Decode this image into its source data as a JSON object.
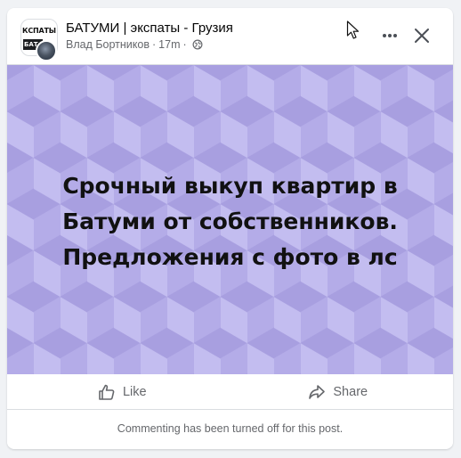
{
  "post": {
    "group_name": "БАТУМИ | экспаты - Грузия",
    "author": "Влад Бортников",
    "separator": "·",
    "time": "17m",
    "avatar_logo_top": "КСПАТЫ",
    "avatar_logo_bottom": "БАТ",
    "image_text_lines": [
      "Срочный выкуп квартир в",
      "Батуми от собственников.",
      "Предложения с фото в лс"
    ],
    "image_background_color": "#b4ace8"
  },
  "actions": {
    "like_label": "Like",
    "share_label": "Share"
  },
  "footer": {
    "comment_notice": "Commenting has been turned off for this post."
  },
  "icons": {
    "globe": "globe-icon",
    "more": "more-icon",
    "close": "close-icon",
    "like": "thumbs-up-icon",
    "share": "share-arrow-icon",
    "cursor": "mouse-cursor-icon"
  },
  "colors": {
    "secondary_text": "#65676b",
    "primary_text": "#050505",
    "divider": "#dadde1"
  }
}
